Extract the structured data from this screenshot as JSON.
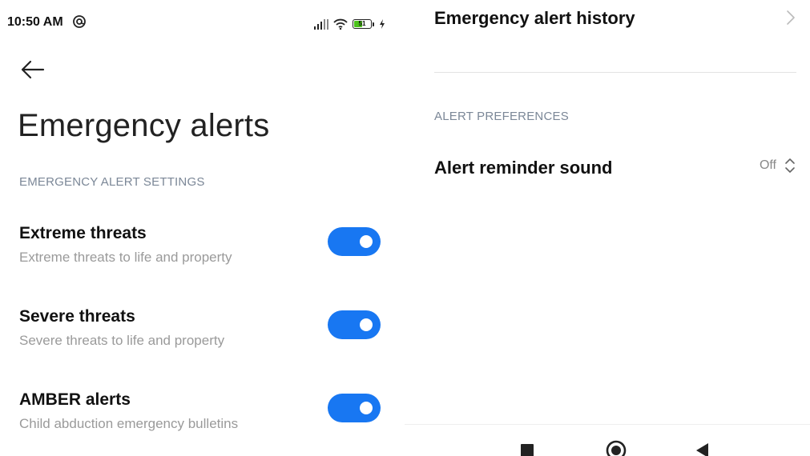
{
  "status_bar": {
    "time": "10:50 AM",
    "battery": "51",
    "battery_level": 0.51,
    "icons": [
      "at-sign-icon",
      "signal-icon",
      "wifi-icon",
      "battery-icon",
      "charging-icon"
    ]
  },
  "header": {
    "back_icon": "arrow-left-icon",
    "title": "Emergency alerts"
  },
  "settings": {
    "section": "EMERGENCY ALERT SETTINGS",
    "items": [
      {
        "title": "Extreme threats",
        "subtitle": "Extreme threats to life and property",
        "enabled": true
      },
      {
        "title": "Severe threats",
        "subtitle": "Severe threats to life and property",
        "enabled": true
      },
      {
        "title": "AMBER alerts",
        "subtitle": "Child abduction emergency bulletins",
        "enabled": true
      }
    ]
  },
  "history": {
    "title": "Emergency alert history",
    "icon": "chevron-right-icon"
  },
  "preferences": {
    "section": "ALERT PREFERENCES",
    "reminder_title": "Alert reminder sound",
    "reminder_value": "Off",
    "icon": "up-down-chevron-icon"
  },
  "nav": {
    "buttons": [
      "recents-square-icon",
      "home-circle-icon",
      "back-triangle-icon"
    ]
  },
  "colors": {
    "accent": "#1877f2",
    "section_text": "#7b8797",
    "subtitle_text": "#9a9a9a"
  }
}
